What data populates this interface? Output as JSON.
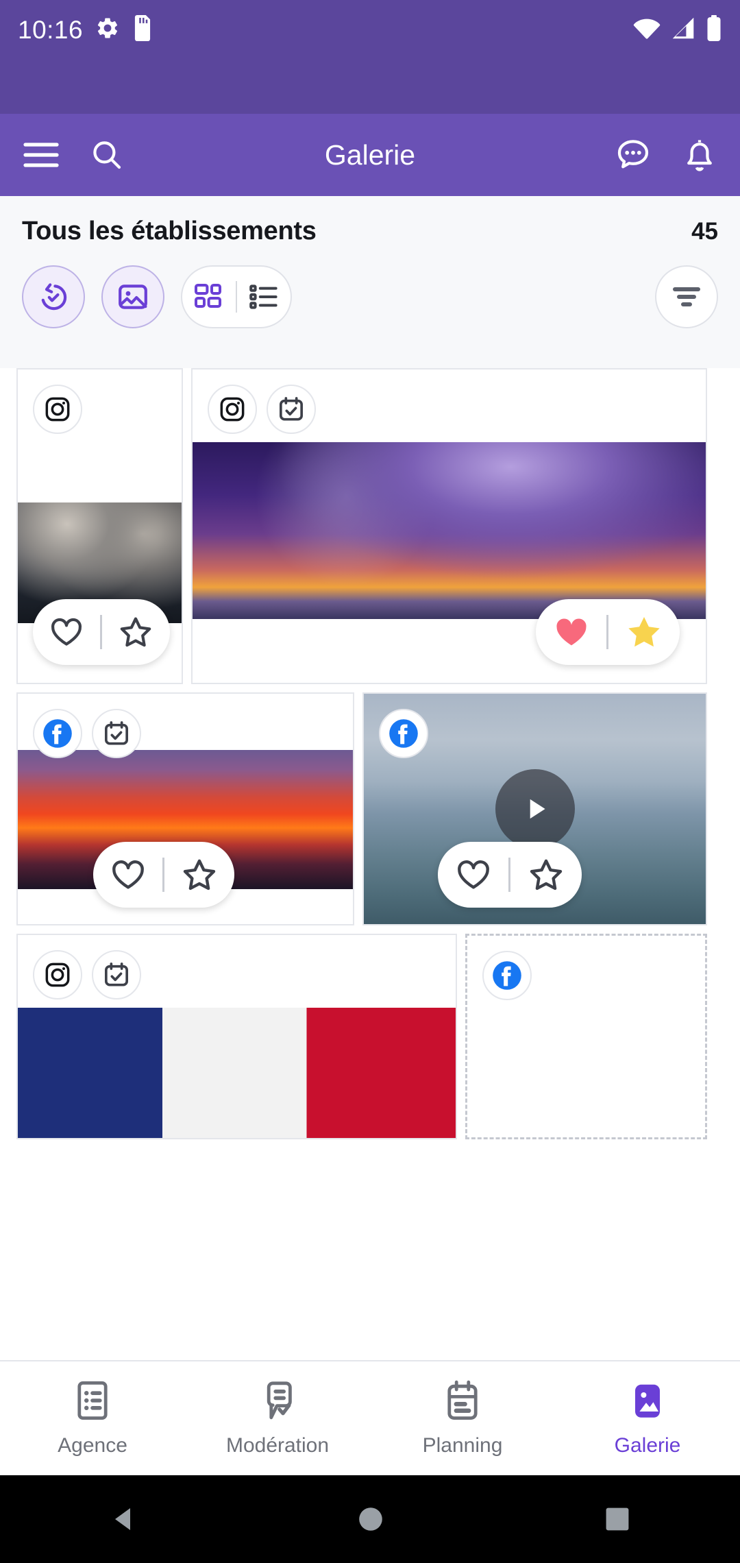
{
  "statusbar": {
    "time": "10:16",
    "icons": [
      "gear-icon",
      "sd-card-icon",
      "wifi-icon",
      "signal-icon",
      "battery-icon"
    ]
  },
  "appbar": {
    "title": "Galerie",
    "menu_icon": "hamburger-menu-icon",
    "search_icon": "search-icon",
    "chat_icon": "chat-bubble-icon",
    "notification_icon": "bell-icon"
  },
  "header": {
    "title": "Tous les établissements",
    "count": "45",
    "toolbar": {
      "history_icon": "history-restore-icon",
      "media_icon": "image-icon",
      "grid_view_icon": "grid-view-icon",
      "list_view_icon": "list-view-icon",
      "filter_icon": "filter-sort-icon"
    }
  },
  "colors": {
    "status_bar": "#5B469C",
    "app_bar": "#6A51B5",
    "accent": "#6A3FD6",
    "chip_active_bg": "#F1EDFB",
    "chip_active_border": "#BDB2E6",
    "heart_active": "#F8697C",
    "star_active": "#F8D34E",
    "facebook_blue": "#1877F2",
    "page_bg": "#F7F8FA"
  },
  "gallery": {
    "cards": [
      {
        "id": "card-1",
        "network": "instagram",
        "scheduled": false,
        "media_type": "image",
        "media_style": "img-storm",
        "liked": false,
        "favorited": false
      },
      {
        "id": "card-2",
        "network": "instagram",
        "scheduled": true,
        "media_type": "image",
        "media_style": "img-galaxy",
        "liked": true,
        "favorited": true
      },
      {
        "id": "card-3",
        "network": "facebook",
        "scheduled": true,
        "media_type": "image",
        "media_style": "img-sunset",
        "liked": false,
        "favorited": false
      },
      {
        "id": "card-4",
        "network": "facebook",
        "scheduled": false,
        "media_type": "video",
        "media_style": "img-sea",
        "liked": false,
        "favorited": false
      },
      {
        "id": "card-5",
        "network": "instagram",
        "scheduled": true,
        "media_type": "image",
        "media_style": "img-flag",
        "liked": false,
        "favorited": false
      },
      {
        "id": "card-6",
        "network": "facebook",
        "scheduled": false,
        "media_type": "placeholder",
        "media_style": "",
        "liked": false,
        "favorited": false
      }
    ],
    "action_icons": {
      "like": "heart-icon",
      "favorite": "star-icon",
      "play": "play-icon"
    }
  },
  "bottomnav": {
    "items": [
      {
        "label": "Agence",
        "icon": "list-icon",
        "active": false
      },
      {
        "label": "Modération",
        "icon": "comment-check-icon",
        "active": false
      },
      {
        "label": "Planning",
        "icon": "calendar-icon",
        "active": false
      },
      {
        "label": "Galerie",
        "icon": "image-icon",
        "active": true
      }
    ]
  },
  "sysnav": {
    "back": "back-triangle-icon",
    "home": "home-circle-icon",
    "recents": "recents-square-icon"
  }
}
